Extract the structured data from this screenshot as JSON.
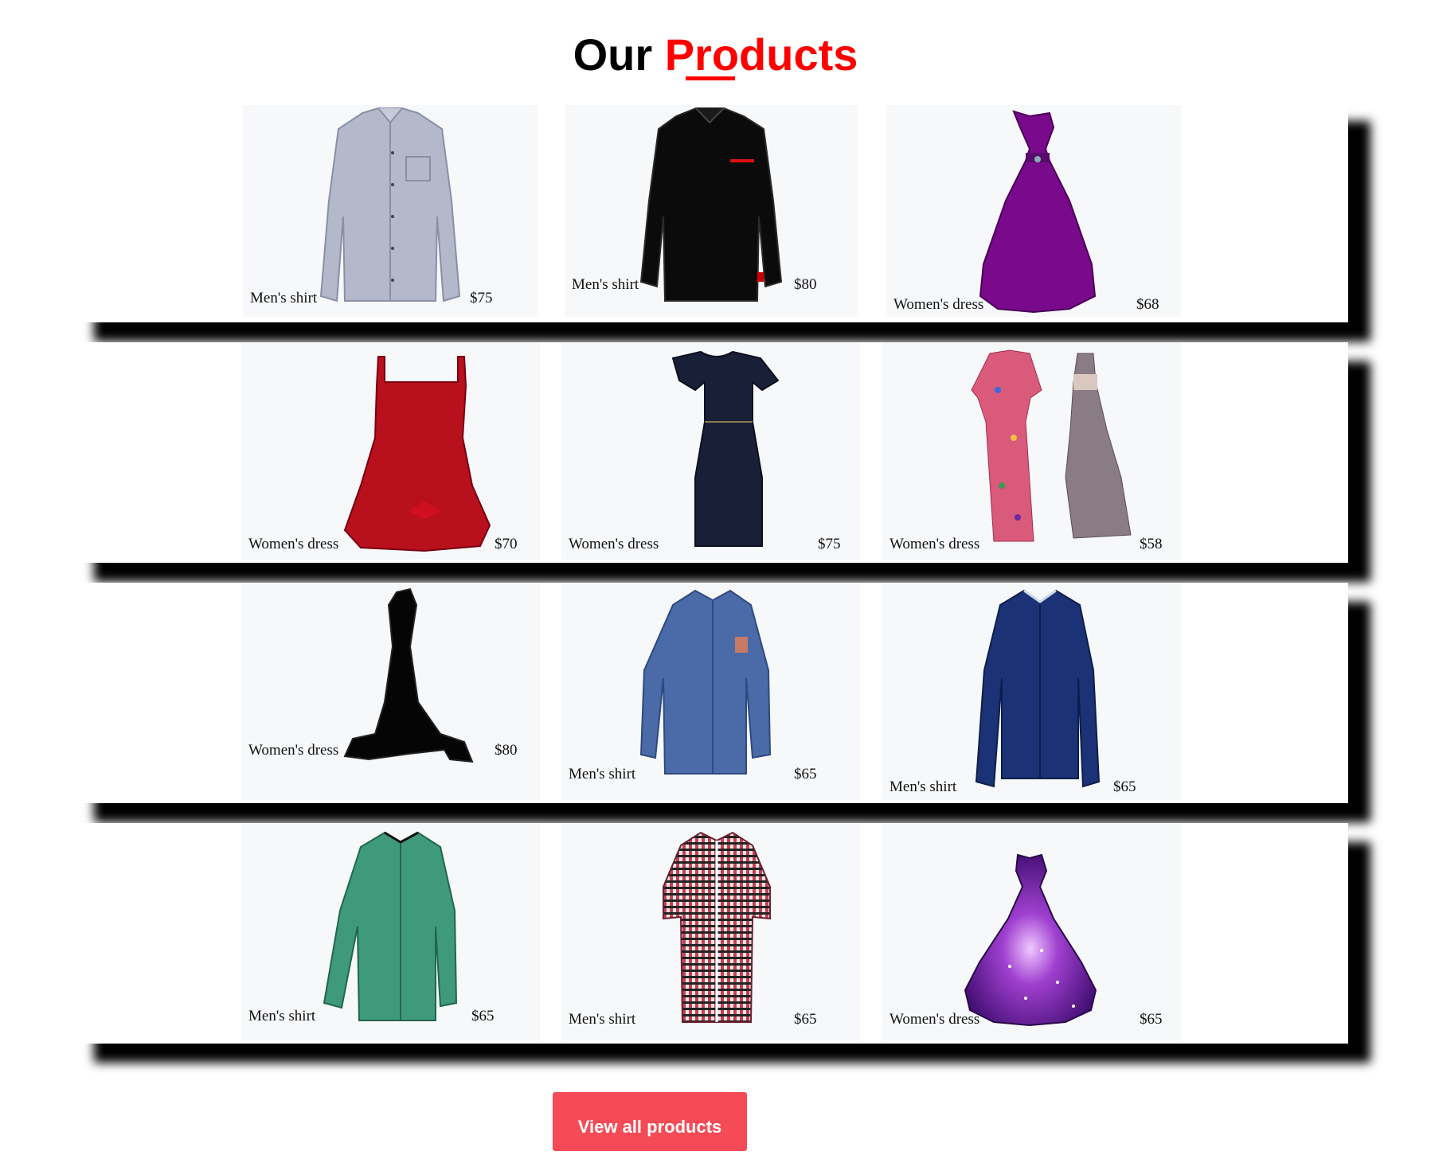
{
  "heading": {
    "part1": "Our ",
    "part2": "Products",
    "accent_color": "#ff0000"
  },
  "rows": [
    {
      "products": [
        {
          "name": "Men's shirt",
          "price": "$75",
          "icon": "light-gray-shirt"
        },
        {
          "name": "Men's shirt",
          "price": "$80",
          "icon": "black-shirt"
        },
        {
          "name": "Women's dress",
          "price": "$68",
          "icon": "purple-gown"
        }
      ]
    },
    {
      "products": [
        {
          "name": "Women's dress",
          "price": "$70",
          "icon": "red-short-dress"
        },
        {
          "name": "Women's dress",
          "price": "$75",
          "icon": "navy-dress"
        },
        {
          "name": "Women's dress",
          "price": "$58",
          "icon": "floral-and-tiered-dresses"
        }
      ]
    },
    {
      "products": [
        {
          "name": "Women's dress",
          "price": "$80",
          "icon": "black-mermaid-gown"
        },
        {
          "name": "Men's shirt",
          "price": "$65",
          "icon": "blue-shirt"
        },
        {
          "name": "Men's shirt",
          "price": "$65",
          "icon": "navy-shirt"
        }
      ]
    },
    {
      "products": [
        {
          "name": "Men's shirt",
          "price": "$65",
          "icon": "green-shirt"
        },
        {
          "name": "Men's shirt",
          "price": "$65",
          "icon": "checked-shirt"
        },
        {
          "name": "Women's dress",
          "price": "$65",
          "icon": "galaxy-purple-gown"
        }
      ]
    }
  ],
  "cta": {
    "label": "View all products",
    "color": "#f44b57"
  }
}
